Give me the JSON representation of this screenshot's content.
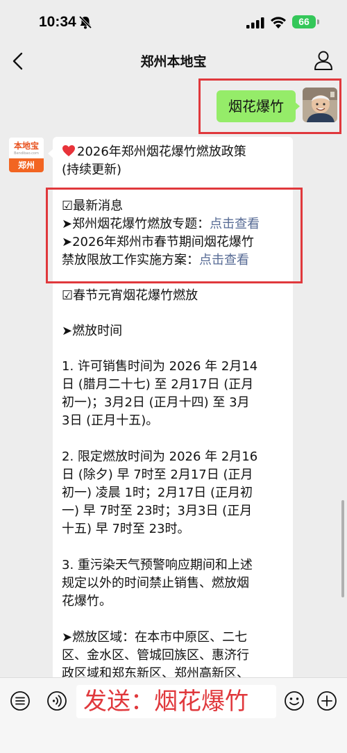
{
  "status_bar": {
    "time": "10:34",
    "battery": "66",
    "colors": {
      "battery": "#34c759"
    }
  },
  "nav": {
    "title": "郑州本地宝"
  },
  "outgoing": {
    "text": "烟花爆竹"
  },
  "sender": {
    "logo_brand": "本地宝",
    "logo_url": "Bendibao.com",
    "logo_city": "郑州"
  },
  "message": {
    "title_line1": "2026年郑州烟花爆竹燃放政策",
    "title_line2": "(持续更新)",
    "latest_heading": "☑最新消息",
    "latest_1_text": "➤郑州烟花爆竹燃放专题：",
    "latest_1_link": "点击查看",
    "latest_2_line1": "➤2026年郑州市春节期间烟花爆竹",
    "latest_2_text": "禁放限放工作实施方案：",
    "latest_2_link": "点击查看",
    "section_heading": "☑春节元宵烟花爆竹燃放",
    "time_heading": "➤燃放时间",
    "item1_line1": "1. 许可销售时间为 2026 年 2月14",
    "item1_line2": "日 (腊月二十七) 至 2月17日 (正月",
    "item1_line3": "初一)；3月2日 (正月十四) 至 3月",
    "item1_line4": "3日 (正月十五)。",
    "item2_line1": "2. 限定燃放时间为 2026 年 2月16",
    "item2_line2": "日 (除夕) 早 7时至 2月17日 (正月",
    "item2_line3": "初一) 凌晨 1时；2月17日 (正月初",
    "item2_line4": "一) 早 7时至 23时；3月3日 (正月",
    "item2_line5": "十五) 早 7时至 23时。",
    "item3_line1": "3. 重污染天气预警响应期间和上述",
    "item3_line2": "规定以外的时间禁止销售、燃放烟",
    "item3_line3": "花爆竹。",
    "area_line1": "➤燃放区域：在本市中原区、二七",
    "area_line2": "区、金水区、管城回族区、惠济行",
    "area_line3": "政区域和郑东新区、郑州高新区、"
  },
  "input": {
    "overlay_text": "发送：烟花爆竹"
  },
  "icons": [
    "bell-off-icon",
    "signal-icon",
    "wifi-icon",
    "back-icon",
    "profile-icon",
    "heart-icon",
    "menu-icon",
    "voice-icon",
    "emoji-icon",
    "plus-icon"
  ],
  "colors": {
    "bubble_out": "#95ec69",
    "link": "#576b95",
    "highlight": "#e0383c",
    "logo_orange": "#f26522",
    "background": "#ededed"
  }
}
